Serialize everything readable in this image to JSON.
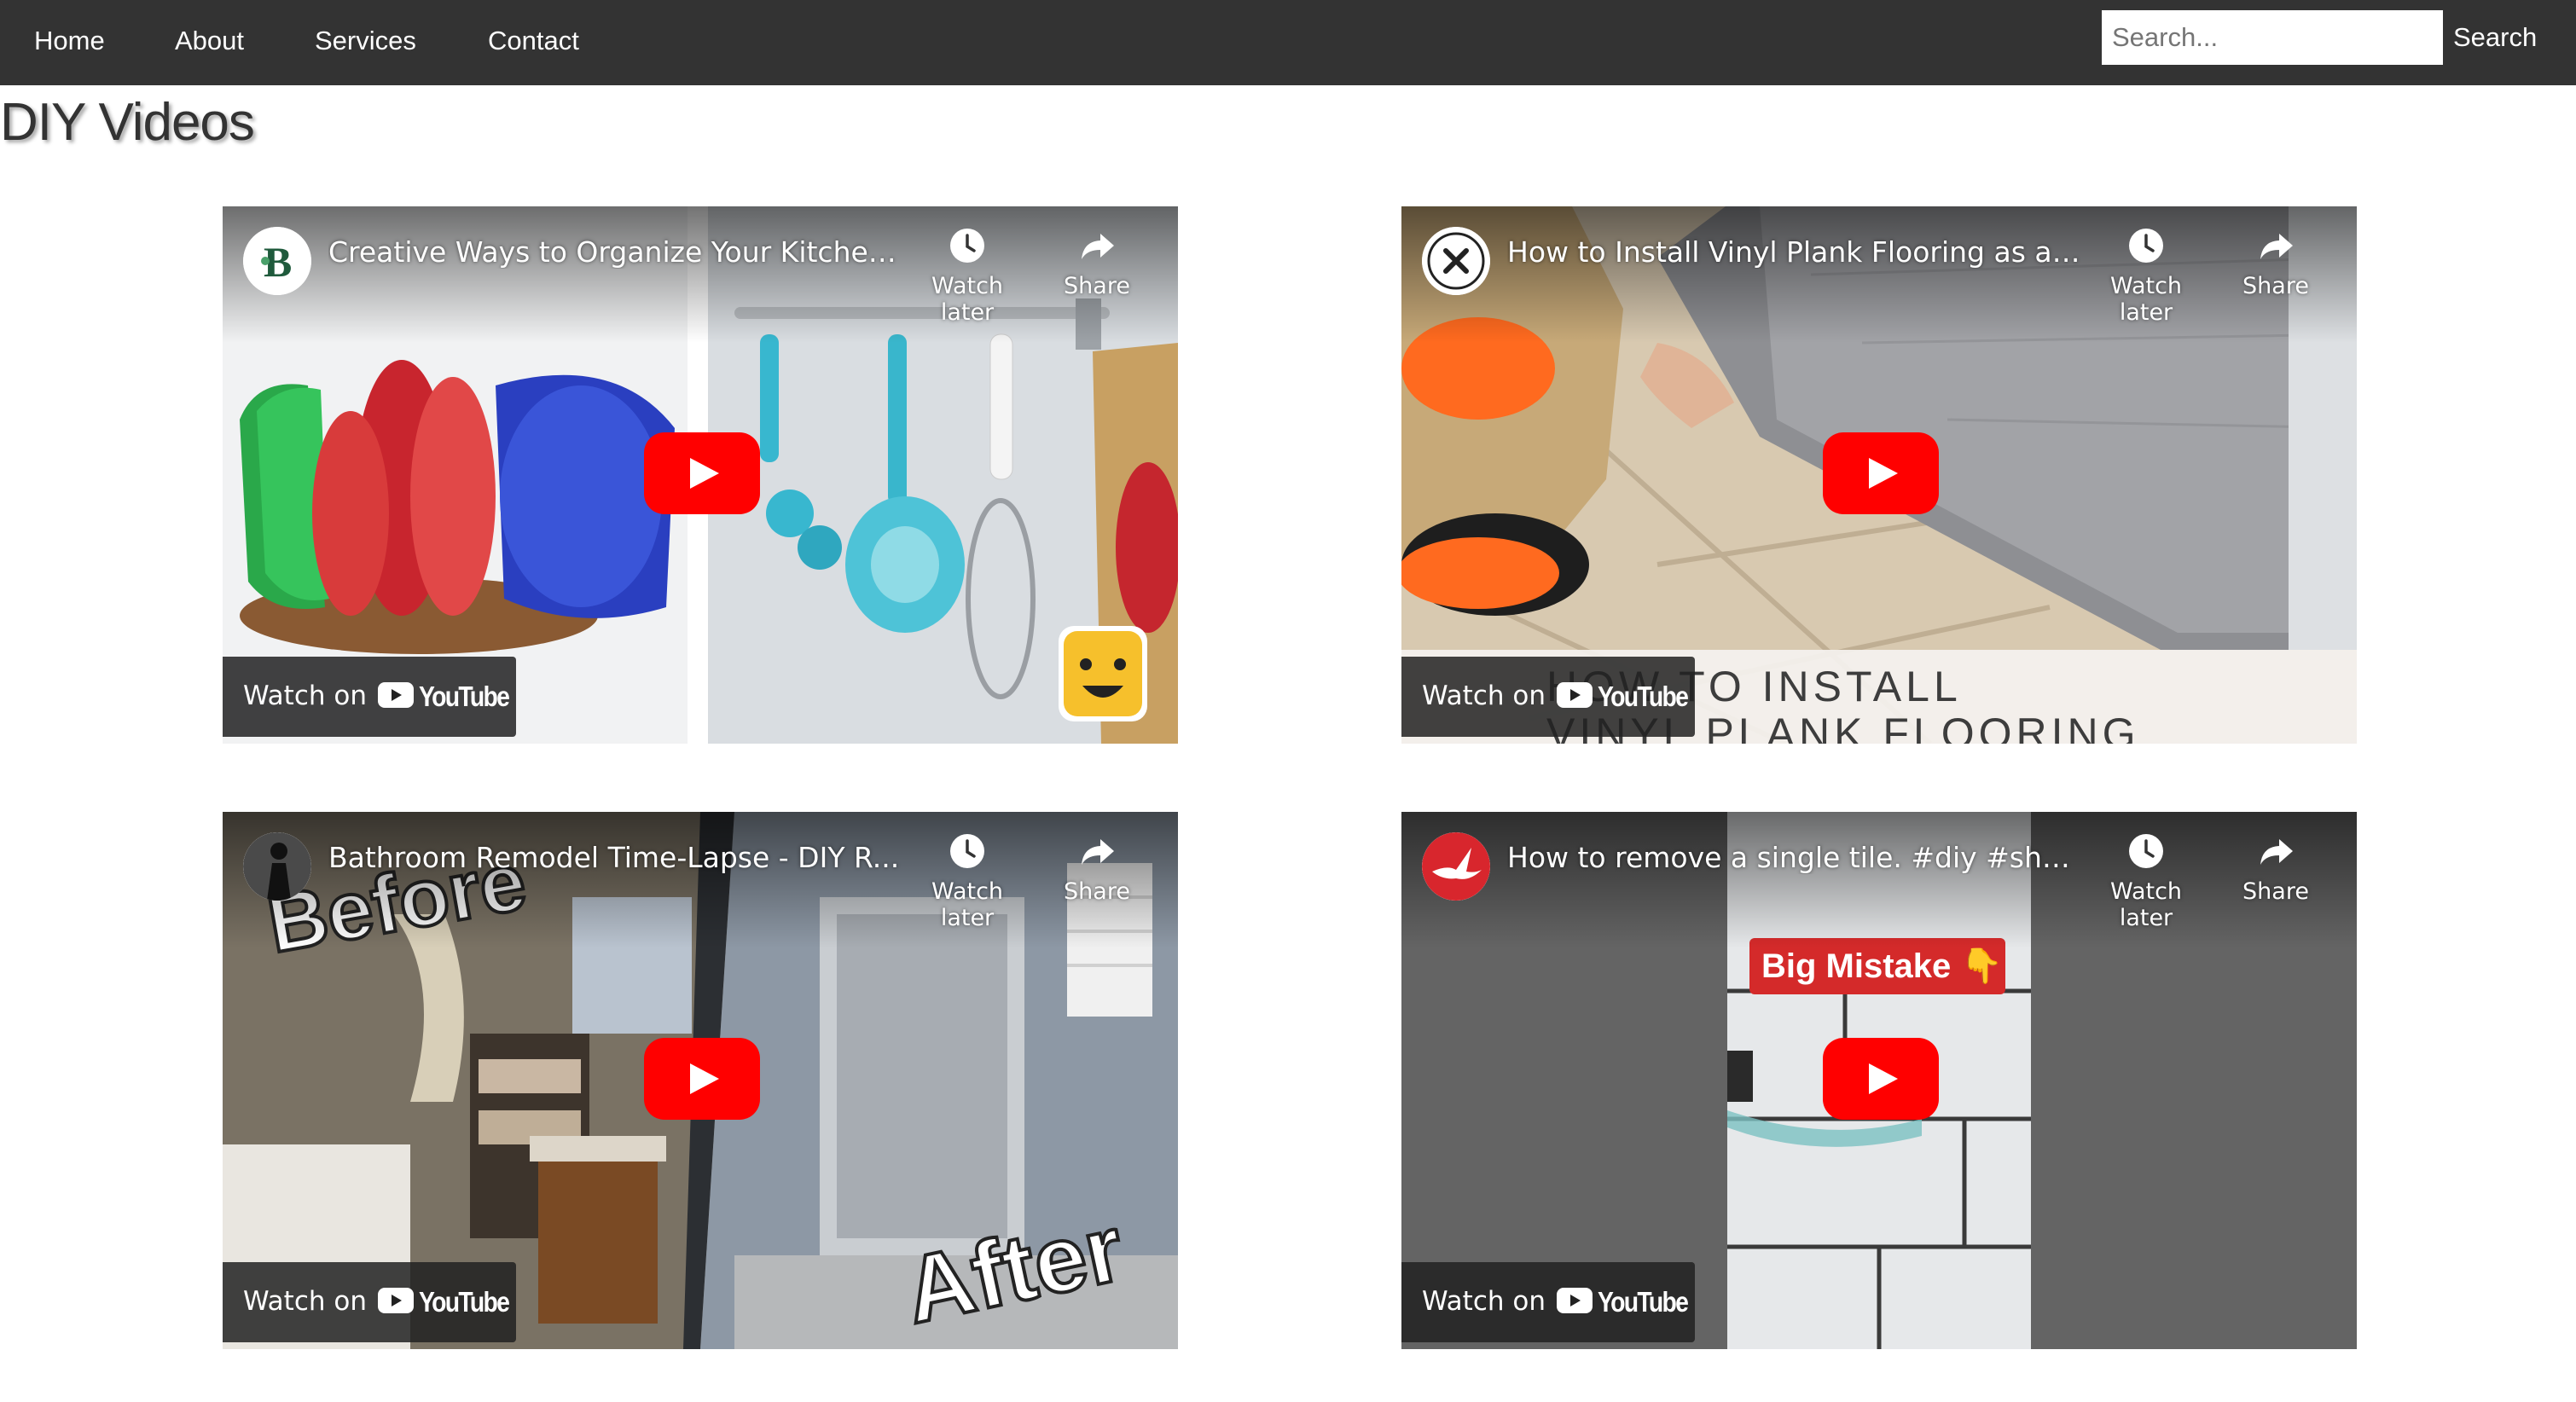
{
  "nav": {
    "items": [
      {
        "label": "Home"
      },
      {
        "label": "About"
      },
      {
        "label": "Services"
      },
      {
        "label": "Contact"
      }
    ],
    "search": {
      "placeholder": "Search...",
      "button_label": "Search"
    }
  },
  "page_title": "DIY Videos",
  "videos": [
    {
      "title": "Creative Ways to Organize Your Kitchen...",
      "channel_icon": "leaf-b-logo-icon",
      "watch_later_label": "Watch later",
      "share_label": "Share",
      "watch_on_label": "Watch on",
      "youtube_label": "YouTube"
    },
    {
      "title": "How to Install Vinyl Plank Flooring as a ...",
      "channel_icon": "tools-badge-icon",
      "watch_later_label": "Watch later",
      "share_label": "Share",
      "watch_on_label": "Watch on",
      "youtube_label": "YouTube",
      "thumbnail_text": [
        "HOW TO INSTALL",
        "VINYL PLANK FLOORING"
      ]
    },
    {
      "title": "Bathroom Remodel Time-Lapse - DIY R...",
      "channel_icon": "person-silhouette-icon",
      "watch_later_label": "Watch later",
      "share_label": "Share",
      "watch_on_label": "Watch on",
      "youtube_label": "YouTube",
      "thumbnail_text": [
        "Before",
        "After"
      ]
    },
    {
      "title": "How to remove a single tile. #diy #shor...",
      "channel_icon": "bird-logo-icon",
      "watch_later_label": "Watch later",
      "share_label": "Share",
      "watch_on_label": "Watch on",
      "youtube_label": "YouTube",
      "thumbnail_text": [
        "Big Mistake 👇"
      ]
    }
  ],
  "colors": {
    "navbar": "#333333",
    "youtube_red": "#ff0000",
    "overlay": "#212121"
  }
}
